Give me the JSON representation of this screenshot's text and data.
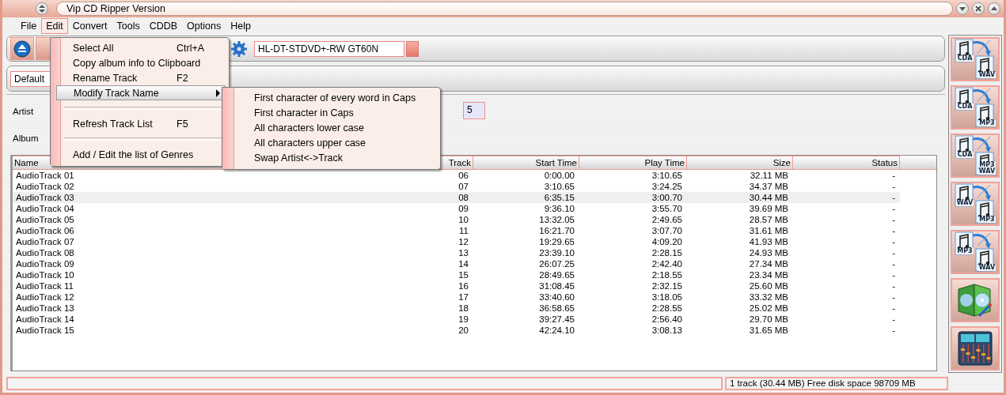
{
  "window": {
    "title": "Vip CD Ripper Version"
  },
  "menubar": [
    {
      "label": "File",
      "selected": false
    },
    {
      "label": "Edit",
      "selected": true
    },
    {
      "label": "Convert",
      "selected": false
    },
    {
      "label": "Tools",
      "selected": false
    },
    {
      "label": "CDDB",
      "selected": false
    },
    {
      "label": "Options",
      "selected": false
    },
    {
      "label": "Help",
      "selected": false
    }
  ],
  "toolbar": {
    "drive": "HL-DT-STDVD+-RW GT60N",
    "profile": "Default"
  },
  "album_info": {
    "artist_label": "Artist",
    "album_label": "Album",
    "track_count": "5"
  },
  "table": {
    "columns": [
      "Name",
      "Track",
      "Start Time",
      "Play Time",
      "Size",
      "Status"
    ],
    "rows": [
      {
        "cells": [
          "AudioTrack 01",
          "06",
          "0:00.00",
          "3:10.65",
          "32.11 MB",
          "-"
        ],
        "selected": false
      },
      {
        "cells": [
          "AudioTrack 02",
          "07",
          "3:10.65",
          "3:24.25",
          "34.37 MB",
          "-"
        ],
        "selected": false
      },
      {
        "cells": [
          "AudioTrack 03",
          "08",
          "6:35.15",
          "3:00.70",
          "30.44 MB",
          "-"
        ],
        "selected": true
      },
      {
        "cells": [
          "AudioTrack 04",
          "09",
          "9:36.10",
          "3:55.70",
          "39.69 MB",
          "-"
        ],
        "selected": false
      },
      {
        "cells": [
          "AudioTrack 05",
          "10",
          "13:32.05",
          "2:49.65",
          "28.57 MB",
          "-"
        ],
        "selected": false
      },
      {
        "cells": [
          "AudioTrack 06",
          "11",
          "16:21.70",
          "3:07.70",
          "31.61 MB",
          "-"
        ],
        "selected": false
      },
      {
        "cells": [
          "AudioTrack 07",
          "12",
          "19:29.65",
          "4:09.20",
          "41.93 MB",
          "-"
        ],
        "selected": false
      },
      {
        "cells": [
          "AudioTrack 08",
          "13",
          "23:39.10",
          "2:28.15",
          "24.93 MB",
          "-"
        ],
        "selected": false
      },
      {
        "cells": [
          "AudioTrack 09",
          "14",
          "26:07.25",
          "2:42.40",
          "27.34 MB",
          "-"
        ],
        "selected": false
      },
      {
        "cells": [
          "AudioTrack 10",
          "15",
          "28:49.65",
          "2:18.55",
          "23.34 MB",
          "-"
        ],
        "selected": false
      },
      {
        "cells": [
          "AudioTrack 11",
          "16",
          "31:08.45",
          "2:32.15",
          "25.60 MB",
          "-"
        ],
        "selected": false
      },
      {
        "cells": [
          "AudioTrack 12",
          "17",
          "33:40.60",
          "3:18.05",
          "33.32 MB",
          "-"
        ],
        "selected": false
      },
      {
        "cells": [
          "AudioTrack 13",
          "18",
          "36:58.65",
          "2:28.55",
          "25.02 MB",
          "-"
        ],
        "selected": false
      },
      {
        "cells": [
          "AudioTrack 14",
          "19",
          "39:27.45",
          "2:56.40",
          "29.70 MB",
          "-"
        ],
        "selected": false
      },
      {
        "cells": [
          "AudioTrack 15",
          "20",
          "42:24.10",
          "3:08.13",
          "31.65 MB",
          "-"
        ],
        "selected": false
      }
    ]
  },
  "sidebar": [
    {
      "kind": "convert",
      "from": "CDA",
      "to": [
        "WAV"
      ]
    },
    {
      "kind": "convert",
      "from": "CDA",
      "to": [
        "MP3"
      ]
    },
    {
      "kind": "convert",
      "from": "CDA",
      "to": [
        "MP3",
        "WAV"
      ]
    },
    {
      "kind": "convert",
      "from": "WAV",
      "to": [
        "MP3"
      ]
    },
    {
      "kind": "convert",
      "from": "MP3",
      "to": [
        "WAV"
      ]
    },
    {
      "kind": "disc-case"
    },
    {
      "kind": "mixer"
    }
  ],
  "edit_menu": {
    "items": [
      {
        "kind": "item",
        "label": "Select All",
        "shortcut": "Ctrl+A",
        "selected": false
      },
      {
        "kind": "item",
        "label": "Copy album info to Clipboard",
        "selected": false
      },
      {
        "kind": "item",
        "label": "Rename Track",
        "shortcut": "F2",
        "selected": false
      },
      {
        "kind": "submenu",
        "label": "Modify Track Name",
        "selected": true
      },
      {
        "kind": "separator"
      },
      {
        "kind": "item",
        "label": "Refresh Track List",
        "shortcut": "F5",
        "selected": false
      },
      {
        "kind": "separator"
      },
      {
        "kind": "item",
        "label": "Add / Edit the list of Genres",
        "selected": false
      }
    ]
  },
  "submenu": {
    "items": [
      {
        "kind": "item",
        "label": "First character of every word in Caps",
        "selected": false
      },
      {
        "kind": "item",
        "label": "First character in Caps",
        "selected": false
      },
      {
        "kind": "item",
        "label": "All characters lower case",
        "selected": false
      },
      {
        "kind": "item",
        "label": "All characters upper case",
        "selected": false
      },
      {
        "kind": "item",
        "label": "Swap Artist<->Track",
        "selected": false
      }
    ]
  },
  "status_bar": {
    "info": "1 track (30.44 MB) Free disk space 98709 MB"
  }
}
